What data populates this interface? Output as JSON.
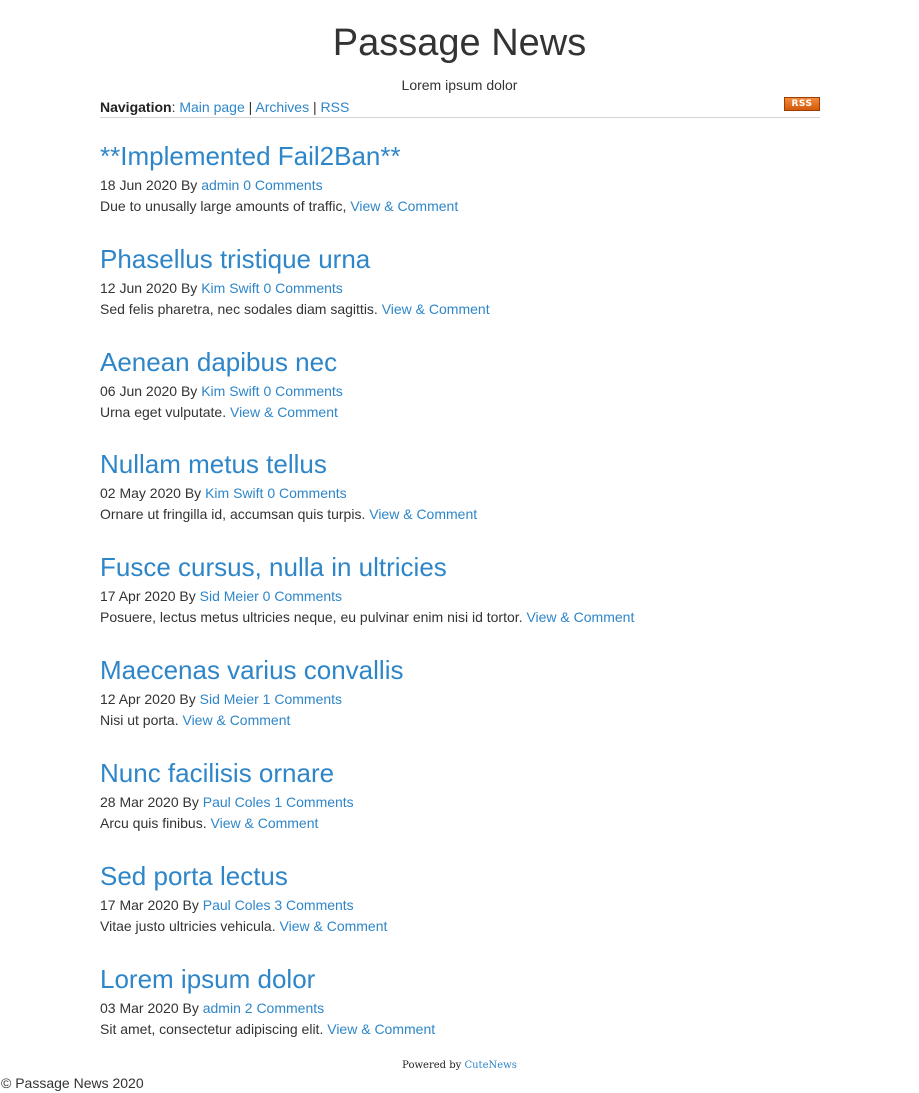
{
  "site": {
    "title": "Passage News",
    "tagline": "Lorem ipsum dolor"
  },
  "nav": {
    "label": "Navigation",
    "colon": ":",
    "items": [
      "Main page",
      "Archives",
      "RSS"
    ],
    "separator": "|",
    "rss_badge": "RSS",
    "rss_badge_color": "#e8731f"
  },
  "posts": [
    {
      "title": "**Implemented Fail2Ban**",
      "date": "18 Jun 2020",
      "by": "By",
      "author": "admin",
      "comments": "0 Comments",
      "excerpt": "Due to unusally large amounts of traffic,",
      "link": "View & Comment"
    },
    {
      "title": "Phasellus tristique urna",
      "date": "12 Jun 2020",
      "by": "By",
      "author": "Kim Swift",
      "comments": "0 Comments",
      "excerpt": "Sed felis pharetra, nec sodales diam sagittis.",
      "link": "View & Comment"
    },
    {
      "title": "Aenean dapibus nec",
      "date": "06 Jun 2020",
      "by": "By",
      "author": "Kim Swift",
      "comments": "0 Comments",
      "excerpt": "Urna eget vulputate.",
      "link": "View & Comment"
    },
    {
      "title": "Nullam metus tellus",
      "date": "02 May 2020",
      "by": "By",
      "author": "Kim Swift",
      "comments": "0 Comments",
      "excerpt": "Ornare ut fringilla id, accumsan quis turpis.",
      "link": "View & Comment"
    },
    {
      "title": "Fusce cursus, nulla in ultricies",
      "date": "17 Apr 2020",
      "by": "By",
      "author": "Sid Meier",
      "comments": "0 Comments",
      "excerpt": "Posuere, lectus metus ultricies neque, eu pulvinar enim nisi id tortor.",
      "link": "View & Comment"
    },
    {
      "title": "Maecenas varius convallis",
      "date": "12 Apr 2020",
      "by": "By",
      "author": "Sid Meier",
      "comments": "1 Comments",
      "excerpt": "Nisi ut porta.",
      "link": "View & Comment"
    },
    {
      "title": "Nunc facilisis ornare",
      "date": "28 Mar 2020",
      "by": "By",
      "author": "Paul Coles",
      "comments": "1 Comments",
      "excerpt": "Arcu quis finibus.",
      "link": "View & Comment"
    },
    {
      "title": "Sed porta lectus",
      "date": "17 Mar 2020",
      "by": "By",
      "author": "Paul Coles",
      "comments": "3 Comments",
      "excerpt": "Vitae justo ultricies vehicula.",
      "link": "View & Comment"
    },
    {
      "title": "Lorem ipsum dolor",
      "date": "03 Mar 2020",
      "by": "By",
      "author": "admin",
      "comments": "2 Comments",
      "excerpt": "Sit amet, consectetur adipiscing elit.",
      "link": "View & Comment"
    }
  ],
  "footer": {
    "powered_by": "Powered by",
    "powered_link": "CuteNews",
    "copyright": "© Passage News 2020"
  },
  "colors": {
    "link": "#2e86c9",
    "text": "#333333"
  }
}
